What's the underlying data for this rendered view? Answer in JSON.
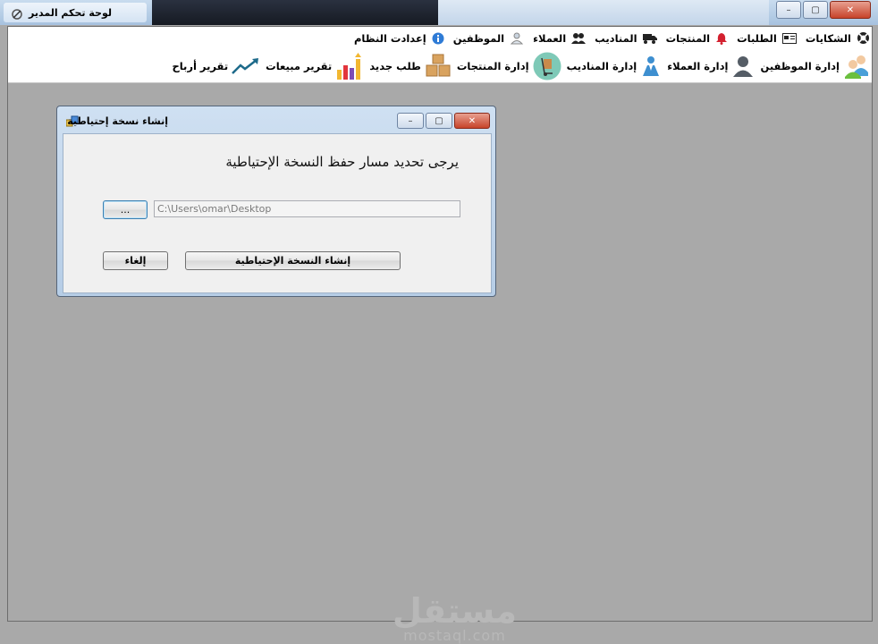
{
  "window": {
    "title": "لوحة تحكم المدير",
    "controls": {
      "minimize": "–",
      "maximize": "▢",
      "close": "✕"
    }
  },
  "menu": {
    "items": [
      {
        "label": "إعدادت النظام",
        "icon": "info-icon"
      },
      {
        "label": "الموظفين",
        "icon": "user-icon"
      },
      {
        "label": "العملاء",
        "icon": "users-icon"
      },
      {
        "label": "المناديب",
        "icon": "truck-icon"
      },
      {
        "label": "المنتجات",
        "icon": "bell-icon"
      },
      {
        "label": "الطلبات",
        "icon": "card-icon"
      },
      {
        "label": "الشكايات",
        "icon": "lifebuoy-icon"
      }
    ]
  },
  "toolbar": {
    "items": [
      {
        "label": "إدارة الموظفين",
        "icon": "employees-icon"
      },
      {
        "label": "إدارة العملاء",
        "icon": "customers-icon"
      },
      {
        "label": "إدارة المناديب",
        "icon": "delivery-icon"
      },
      {
        "label": "إدارة المنتجات",
        "icon": "products-icon"
      },
      {
        "label": "طلب جديد",
        "icon": "boxes-icon"
      },
      {
        "label": "تقرير مبيعات",
        "icon": "bar-chart-icon"
      },
      {
        "label": "تقرير أرباح",
        "icon": "trend-icon"
      }
    ]
  },
  "dialog": {
    "title": "إنشاء نسخة إحتياطية",
    "prompt": "يرجى تحديد مسار حفظ النسخة الإحتياطية",
    "path_value": "C:\\Users\\omar\\Desktop",
    "browse_label": "...",
    "create_label": "إنشاء النسخة الإحتياطية",
    "cancel_label": "إلغاء",
    "controls": {
      "minimize": "–",
      "maximize": "▢",
      "close": "✕"
    }
  },
  "watermark": {
    "arabic": "مستقل",
    "latin": "mostaql.com"
  },
  "colors": {
    "accent": "#3c7fb1",
    "close_button": "#c7432a",
    "client_bg": "#a9a9a9"
  }
}
